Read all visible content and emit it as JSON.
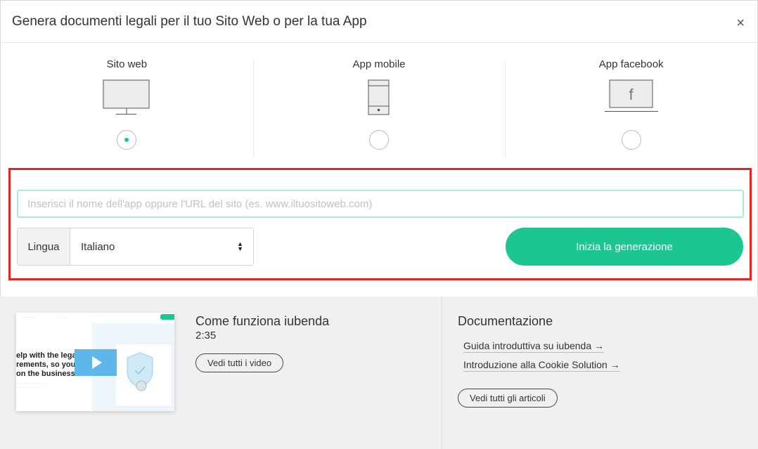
{
  "header": {
    "title": "Genera documenti legali per il tuo Sito Web o per la tua App",
    "close_icon": "×"
  },
  "types": [
    {
      "label": "Sito web",
      "icon": "monitor-icon",
      "selected": true
    },
    {
      "label": "App mobile",
      "icon": "phone-icon",
      "selected": false
    },
    {
      "label": "App facebook",
      "icon": "facebook-icon",
      "selected": false
    }
  ],
  "facebook_glyph": "f",
  "form": {
    "url_placeholder": "Inserisci il nome dell'app oppure l'URL del sito (es. www.iltuositoweb.com)",
    "url_value": "",
    "lang_label": "Lingua",
    "lang_value": "Italiano",
    "start_label": "Inizia la generazione"
  },
  "video": {
    "title": "Come funziona iubenda",
    "duration": "2:35",
    "all_videos_label": "Vedi tutti i video",
    "thumb_text_line1": "elp with the legal",
    "thumb_text_line2": "rements, so you can",
    "thumb_text_line3": "on the business"
  },
  "docs": {
    "title": "Documentazione",
    "links": [
      "Guida introduttiva su iubenda →",
      "Introduzione alla Cookie Solution →"
    ],
    "all_articles_label": "Vedi tutti gli articoli"
  },
  "colors": {
    "accent": "#1cc691",
    "highlight_border": "#e8241c",
    "play": "#5fb6ea"
  }
}
